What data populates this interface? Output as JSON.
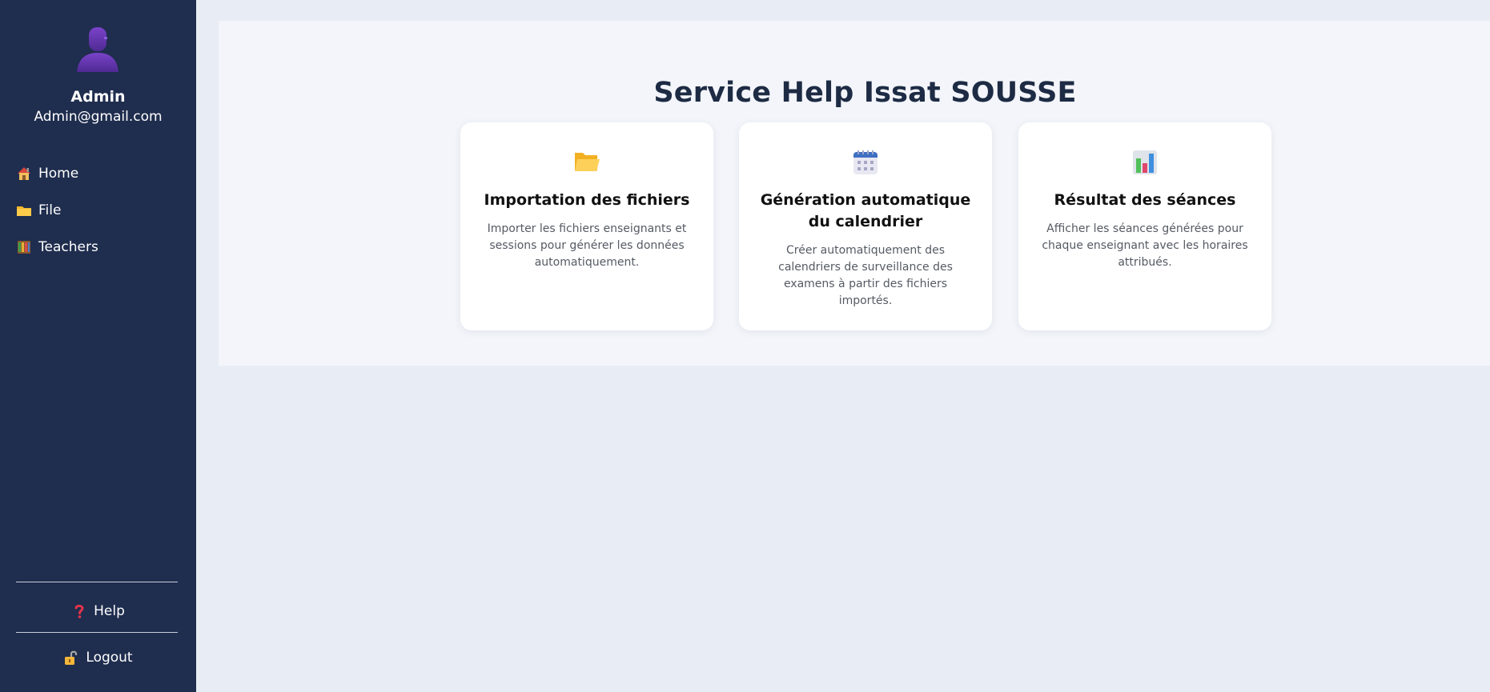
{
  "sidebar": {
    "profile": {
      "name": "Admin",
      "email": "Admin@gmail.com",
      "avatar_icon": "user-avatar-icon"
    },
    "nav": [
      {
        "label": "Home",
        "icon": "house-icon"
      },
      {
        "label": "File",
        "icon": "folder-icon"
      },
      {
        "label": "Teachers",
        "icon": "teachers-icon"
      }
    ],
    "help": {
      "label": "Help",
      "icon": "question-mark-icon"
    },
    "logout": {
      "label": "Logout",
      "icon": "unlock-icon"
    }
  },
  "main": {
    "title": "Service Help Issat SOUSSE",
    "cards": [
      {
        "title": "Importation des fichiers",
        "description": "Importer les fichiers enseignants et sessions pour générer les données automatiquement.",
        "icon": "open-folder-icon"
      },
      {
        "title": "Génération automatique du calendrier",
        "description": "Créer automatiquement des calendriers de surveillance des examens à partir des fichiers importés.",
        "icon": "calendar-icon"
      },
      {
        "title": "Résultat des séances",
        "description": "Afficher les séances générées pour chaque enseignant avec les horaires attribués.",
        "icon": "bar-chart-icon"
      }
    ]
  },
  "colors": {
    "sidebar_bg": "#1f2d4e",
    "page_bg": "#e8edf5",
    "panel_bg": "#f3f5fa",
    "title_text": "#1d2b44"
  }
}
